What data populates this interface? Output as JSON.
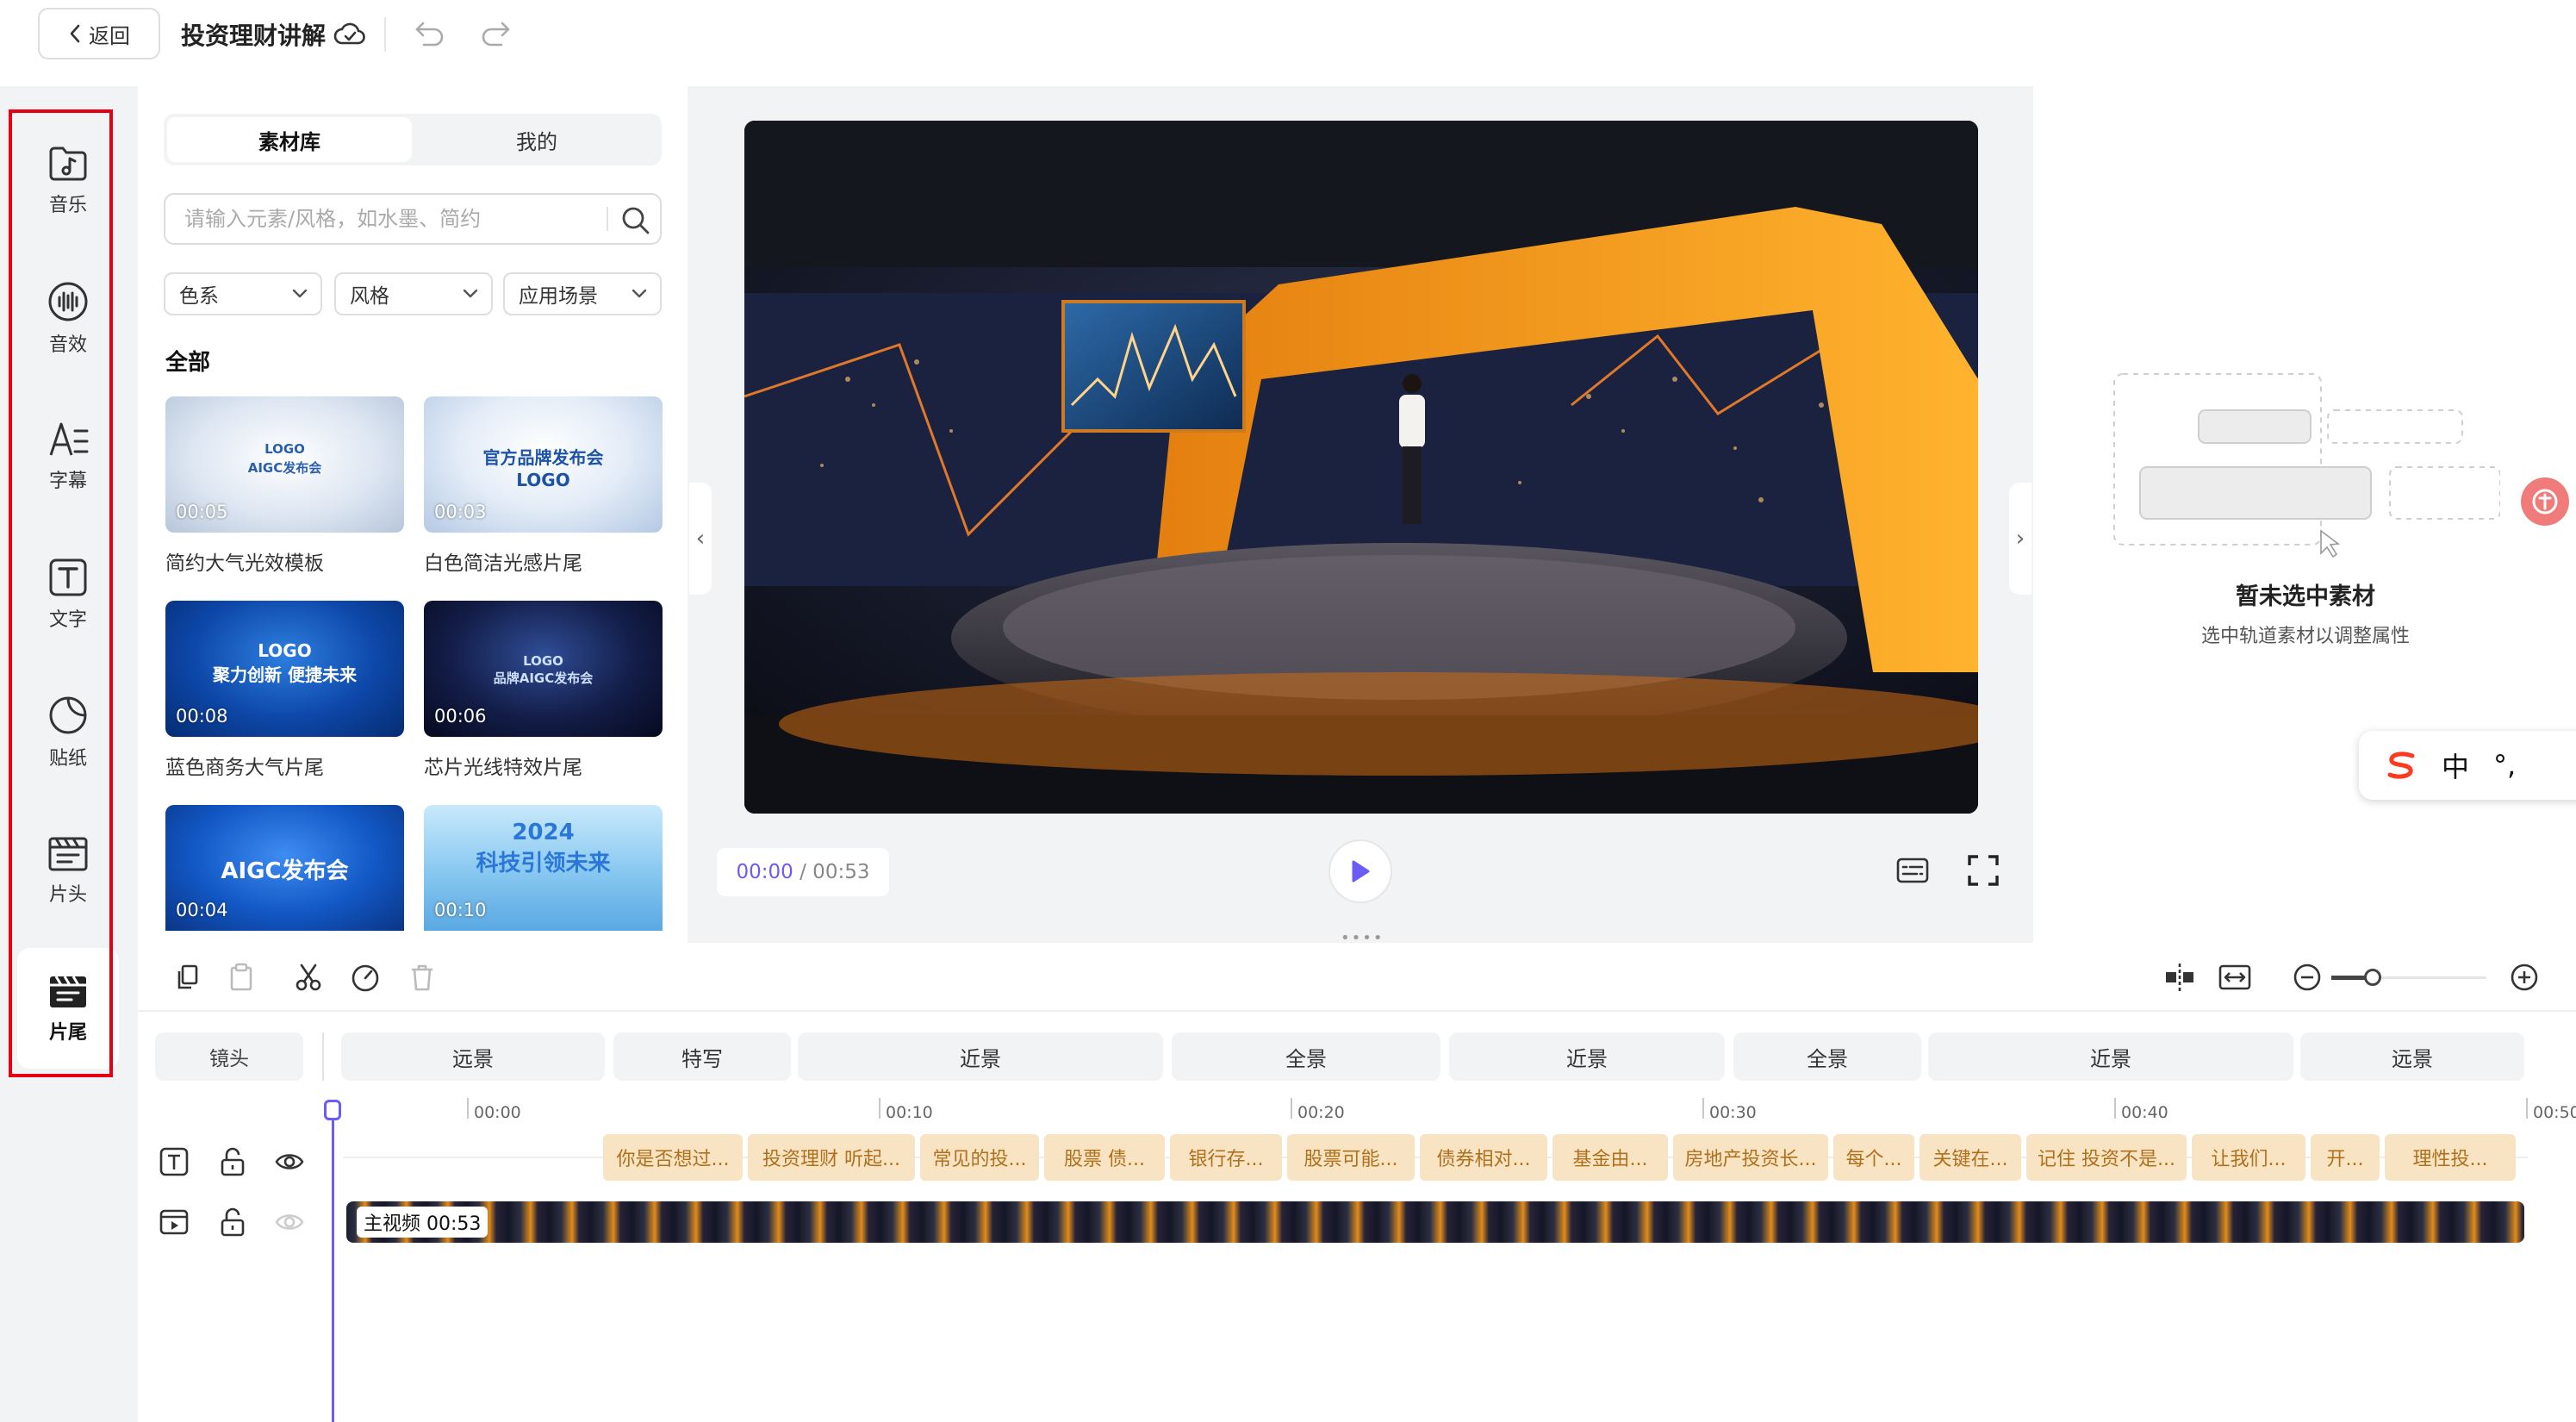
{
  "header": {
    "back_label": "返回",
    "project_title": "投资理财讲解"
  },
  "rail": {
    "items": [
      {
        "label": "音乐",
        "icon": "music-icon"
      },
      {
        "label": "音效",
        "icon": "sound-effect-icon"
      },
      {
        "label": "字幕",
        "icon": "subtitle-icon"
      },
      {
        "label": "文字",
        "icon": "text-icon"
      },
      {
        "label": "贴纸",
        "icon": "sticker-icon"
      },
      {
        "label": "片头",
        "icon": "intro-icon"
      },
      {
        "label": "片尾",
        "icon": "outro-icon"
      }
    ],
    "active": "片尾"
  },
  "panel": {
    "tabs": [
      "素材库",
      "我的"
    ],
    "search_placeholder": "请输入元素/风格，如水墨、简约",
    "filters": [
      "色系",
      "风格",
      "应用场景"
    ],
    "section_title": "全部",
    "cards": [
      {
        "thumb_text": "LOGO\nAIGC发布会",
        "duration": "00:05",
        "name": "简约大气光效模板"
      },
      {
        "thumb_text": "官方品牌发布会\nLOGO",
        "duration": "00:03",
        "name": "白色简洁光感片尾"
      },
      {
        "thumb_text": "LOGO\n聚力创新 便捷未来",
        "duration": "00:08",
        "name": "蓝色商务大气片尾"
      },
      {
        "thumb_text": "LOGO\n品牌AIGC发布会",
        "duration": "00:06",
        "name": "芯片光线特效片尾"
      },
      {
        "thumb_text": "AIGC发布会",
        "duration": "00:04",
        "name": ""
      },
      {
        "thumb_text": "2024\n科技引领未来",
        "duration": "00:10",
        "name": ""
      }
    ]
  },
  "player": {
    "current_time": "00:00",
    "total_time": "/ 00:53"
  },
  "props": {
    "empty_title": "暂未选中素材",
    "empty_subtitle": "选中轨道素材以调整属性"
  },
  "ime": {
    "lang": "中",
    "punct": "°,"
  },
  "timeline": {
    "shot_label": "镜头",
    "shots": [
      "远景",
      "特写",
      "近景",
      "全景",
      "近景",
      "全景",
      "近景",
      "远景"
    ],
    "ruler": [
      "00:00",
      "00:10",
      "00:20",
      "00:30",
      "00:40",
      "00:50"
    ],
    "subtitle_clips": [
      "你是否想过...",
      "投资理财 听起...",
      "常见的投...",
      "股票 债...",
      "银行存...",
      "股票可能...",
      "债券相对...",
      "基金由...",
      "房地产投资长...",
      "每个...",
      "关键在...",
      "记住 投资不是...",
      "让我们...",
      "开...",
      "理性投..."
    ],
    "main_video_label": "主视频 00:53"
  },
  "colors": {
    "accent": "#6b5cf6",
    "highlight_border": "#e60012",
    "subtitle_clip_bg": "#f8e3c3",
    "subtitle_clip_text": "#b0701c"
  }
}
